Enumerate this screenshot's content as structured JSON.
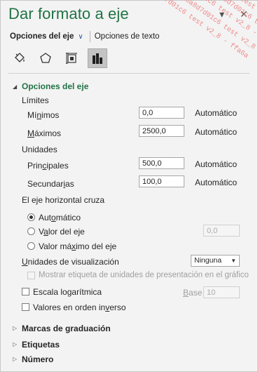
{
  "pane": {
    "title": "Dar formato a eje",
    "window_buttons": {
      "pin": "▾",
      "close": "✕"
    }
  },
  "tabs": [
    {
      "label": "Opciones del eje",
      "active": true
    },
    {
      "label": "Opciones de texto",
      "active": false
    }
  ],
  "icon_tabs": [
    {
      "icon": "fill-bucket-icon",
      "selected": false
    },
    {
      "icon": "pentagon-icon",
      "selected": false
    },
    {
      "icon": "size-properties-icon",
      "selected": false
    },
    {
      "icon": "bar-chart-icon",
      "selected": true
    }
  ],
  "axis_options": {
    "header": "Opciones del eje",
    "limits_label": "Límites",
    "min": {
      "label_pre": "Mí",
      "label_ul": "n",
      "label_post": "imos",
      "value": "0,0",
      "auto": "Automático"
    },
    "max": {
      "label_pre": "",
      "label_ul": "M",
      "label_post": "áximos",
      "value": "2500,0",
      "auto": "Automático"
    },
    "units_label": "Unidades",
    "major": {
      "label_pre": "Prin",
      "label_ul": "c",
      "label_post": "ipales",
      "value": "500,0",
      "auto": "Automático"
    },
    "minor": {
      "label_pre": "Secundar",
      "label_ul": "i",
      "label_post": "as",
      "value": "100,0",
      "auto": "Automático"
    },
    "crosses_label": "El eje horizontal cruza",
    "cross_auto": {
      "label_pre": "Aut",
      "label_ul": "o",
      "label_post": "mático",
      "selected": true
    },
    "cross_value": {
      "label_pre": "V",
      "label_ul": "a",
      "label_post": "lor del eje",
      "value": "0,0",
      "selected": false
    },
    "cross_max": {
      "label_pre": "Valor má",
      "label_ul": "x",
      "label_post": "imo del eje",
      "selected": false
    },
    "display_units": {
      "label_pre": "",
      "label_ul": "U",
      "label_post": "nidades de visualización",
      "value": "Ninguna"
    },
    "show_units_label": "Mostrar etiqueta de unidades de presentación en el gráfico",
    "log_scale": {
      "label_pre": "Escala lo",
      "label_ul": "g",
      "label_post": "arítmica",
      "checked": false,
      "base_label_ul": "B",
      "base_label_post": "ase",
      "base_value": "10"
    },
    "reverse": {
      "label_pre": "Valores en orden in",
      "label_ul": "v",
      "label_post": "erso",
      "checked": false
    }
  },
  "collapsed_sections": [
    "Marcas de graduación",
    "Etiquetas",
    "Número"
  ],
  "watermark": {
    "lines": [
      "d7d01c6 test v2_8 - ffa6a",
      "ffa6a8d7d01c6 test v2_8",
      "d7d01c6 test v2_8 - ffa6a",
      "ffa6a8d7d01c6 test v2_8 -",
      "d01c6 test v2_8 - ffa6a8"
    ]
  },
  "colors": {
    "accent": "#217346",
    "pane_bg": "#f3f3f3",
    "watermark": "#ef8a8a"
  }
}
